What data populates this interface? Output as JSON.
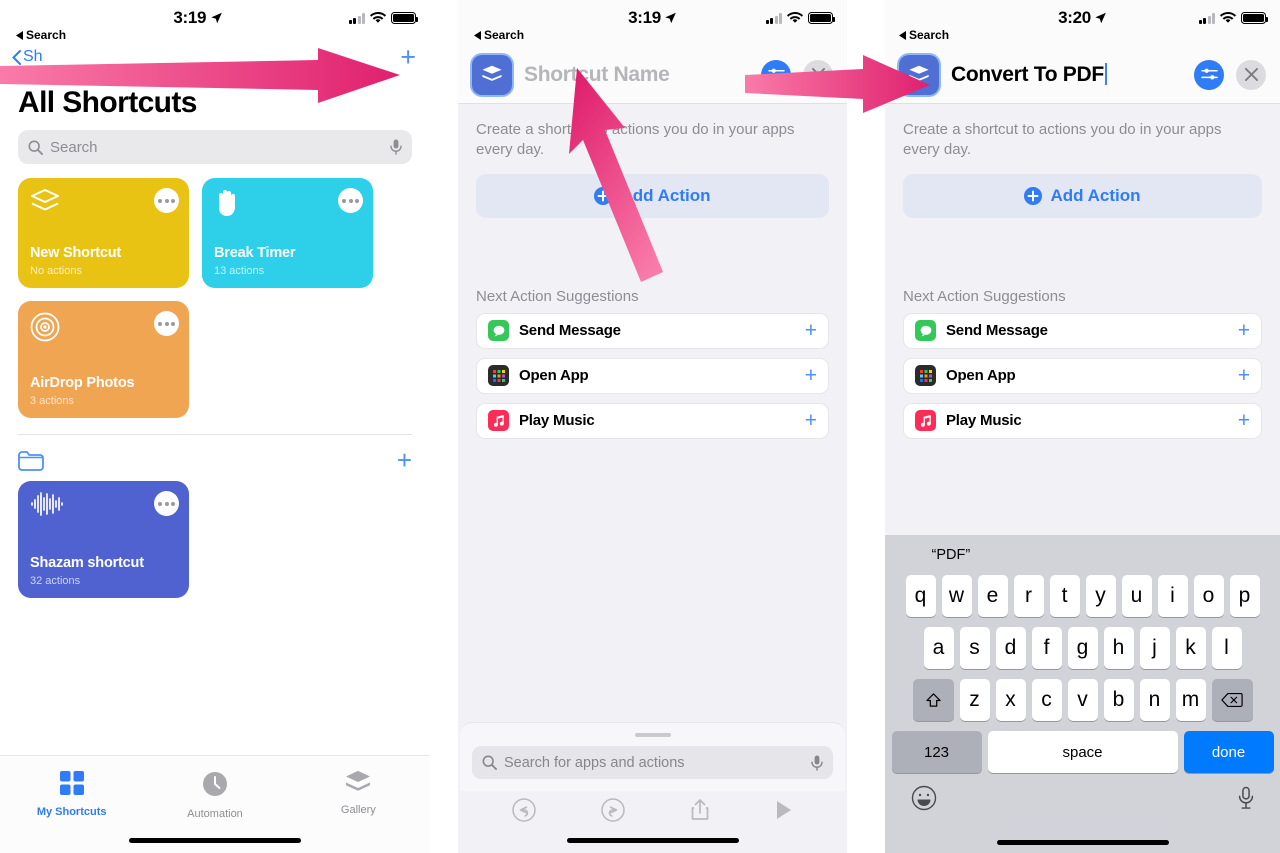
{
  "panel1": {
    "status": {
      "time": "3:19",
      "back_label": "Search",
      "location_icon": "location-arrow-icon",
      "signal_icon": "cellular-bars-icon",
      "wifi_icon": "wifi-icon",
      "battery_icon": "battery-icon"
    },
    "nav": {
      "back_label": "Sh",
      "plus_label": "+"
    },
    "title": "All Shortcuts",
    "search": {
      "placeholder": "Search",
      "icon": "search-icon",
      "mic_icon": "microphone-icon"
    },
    "cards": [
      {
        "name": "New Shortcut",
        "sub": "No actions",
        "color": "#e8c313",
        "icon": "layers-icon"
      },
      {
        "name": "Break Timer",
        "sub": "13 actions",
        "color": "#2dd0e8",
        "icon": "hand-raised-icon"
      },
      {
        "name": "AirDrop Photos",
        "sub": "3 actions",
        "color": "#f0a552",
        "icon": "airdrop-icon"
      }
    ],
    "folder": {
      "icon": "folder-icon",
      "plus_label": "+"
    },
    "folder_cards": [
      {
        "name": "Shazam shortcut",
        "sub": "32 actions",
        "color": "#4f62cf",
        "icon": "waveform-icon"
      }
    ],
    "tabs": [
      {
        "label": "My Shortcuts",
        "icon": "grid-squares-icon",
        "active": true
      },
      {
        "label": "Automation",
        "icon": "clock-automation-icon",
        "active": false
      },
      {
        "label": "Gallery",
        "icon": "layers-stack-icon",
        "active": false
      }
    ]
  },
  "panel2": {
    "status": {
      "time": "3:19",
      "back_label": "Search"
    },
    "header": {
      "app_icon": "shortcut-layers-icon",
      "name_value": "",
      "name_placeholder": "Shortcut Name",
      "settings_icon": "sliders-icon",
      "close_icon": "close-x-icon"
    },
    "description": "Create a shortcut to actions you do in your apps every day.",
    "add_action_label": "Add Action",
    "add_action_icon": "plus-circle-icon",
    "suggestions_title": "Next Action Suggestions",
    "suggestions": [
      {
        "label": "Send Message",
        "icon": "messages-app-icon",
        "color": "#34c759",
        "plus": "+"
      },
      {
        "label": "Open App",
        "icon": "app-grid-icon",
        "color": "#2b2b2e",
        "plus": "+"
      },
      {
        "label": "Play Music",
        "icon": "music-app-icon",
        "color": "#fb2c55",
        "plus": "+"
      }
    ],
    "sheet_search": {
      "placeholder": "Search for apps and actions",
      "icon": "search-icon",
      "mic_icon": "microphone-icon"
    },
    "toolbar": [
      {
        "icon": "undo-icon"
      },
      {
        "icon": "redo-icon"
      },
      {
        "icon": "share-icon"
      },
      {
        "icon": "play-icon"
      }
    ]
  },
  "panel3": {
    "status": {
      "time": "3:20",
      "back_label": "Search"
    },
    "header": {
      "app_icon": "shortcut-layers-icon",
      "name_value": "Convert To PDF",
      "settings_icon": "sliders-icon",
      "close_icon": "close-x-icon"
    },
    "description": "Create a shortcut to actions you do in your apps every day.",
    "add_action_label": "Add Action",
    "add_action_icon": "plus-circle-icon",
    "suggestions_title": "Next Action Suggestions",
    "suggestions": [
      {
        "label": "Send Message",
        "icon": "messages-app-icon",
        "color": "#34c759",
        "plus": "+"
      },
      {
        "label": "Open App",
        "icon": "app-grid-icon",
        "color": "#2b2b2e",
        "plus": "+"
      },
      {
        "label": "Play Music",
        "icon": "music-app-icon",
        "color": "#fb2c55",
        "plus": "+"
      }
    ],
    "keyboard": {
      "predictions": [
        "“PDF”",
        "",
        ""
      ],
      "row1": [
        "q",
        "w",
        "e",
        "r",
        "t",
        "y",
        "u",
        "i",
        "o",
        "p"
      ],
      "row2": [
        "a",
        "s",
        "d",
        "f",
        "g",
        "h",
        "j",
        "k",
        "l"
      ],
      "row3": [
        "z",
        "x",
        "c",
        "v",
        "b",
        "n",
        "m"
      ],
      "shift_icon": "shift-arrow-icon",
      "backspace_icon": "backspace-icon",
      "numbers_label": "123",
      "space_label": "space",
      "done_label": "done",
      "emoji_icon": "emoji-smiley-icon",
      "dictation_icon": "microphone-icon"
    }
  },
  "annotations": {
    "arrow_color_start": "#f97ba8",
    "arrow_color_end": "#e0206e",
    "arrows": [
      {
        "name": "arrow-to-plus-button"
      },
      {
        "name": "arrow-to-shortcut-name-field"
      },
      {
        "name": "arrow-to-named-shortcut"
      }
    ]
  }
}
